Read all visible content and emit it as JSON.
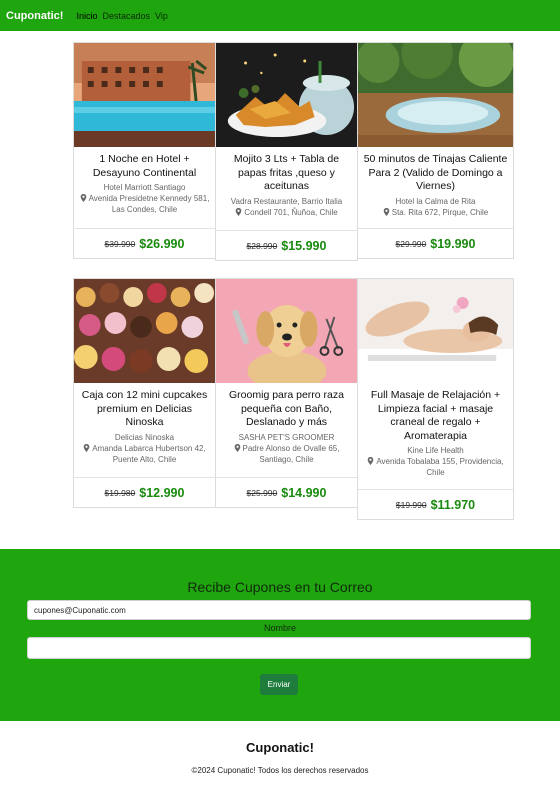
{
  "navbar": {
    "brand": "Cuponatic!",
    "links": [
      {
        "label": "Inicio"
      },
      {
        "label": "Destacados"
      },
      {
        "label": "Vip"
      }
    ]
  },
  "deals": [
    {
      "title": "1 Noche en Hotel + Desayuno Continental",
      "vendor": "Hotel Marriott Santiago",
      "address": "Avenida Presidetne Kennedy 581, Las Condes, Chile",
      "old_price": "$39.990",
      "new_price": "$26.990",
      "image_icon": "hotel-pool-photo"
    },
    {
      "title": "Mojito 3 Lts + Tabla de papas fritas ,queso y aceitunas",
      "vendor": "Vadra Restaurante, Barrio Italia",
      "address": "Condell 701, Ñuñoa, Chile",
      "old_price": "$28.990",
      "new_price": "$15.990",
      "image_icon": "fries-mojito-photo"
    },
    {
      "title": "50 minutos de Tinajas Caliente Para 2 (Valido de Domingo a Viernes)",
      "vendor": "Hotel la Calma de Rita",
      "address": "Sta. Rita 672, Pirque, Chile",
      "old_price": "$29.990",
      "new_price": "$19.990",
      "image_icon": "hot-tub-photo"
    },
    {
      "title": "Caja con 12 mini cupcakes premium en Delicias Ninoska",
      "vendor": "Delicias Ninoska",
      "address": "Amanda Labarca Hubertson 42, Puente Alto, Chile",
      "old_price": "$19.980",
      "new_price": "$12.990",
      "image_icon": "cupcakes-photo"
    },
    {
      "title": "Groomig para perro raza pequeña con Baño, Deslanado y más",
      "vendor": "SASHA PET'S GROOMER",
      "address": "Padre Alonso de Ovalle 65, Santiago, Chile",
      "old_price": "$25.990",
      "new_price": "$14.990",
      "image_icon": "dog-grooming-photo"
    },
    {
      "title": "Full Masaje de Relajación + Limpieza facial + masaje craneal de regalo + Aromaterapia",
      "vendor": "Kine Life Health",
      "address": "Avenida Tobalaba 155, Providencia, Chile",
      "old_price": "$19.990",
      "new_price": "$11.970",
      "image_icon": "massage-photo"
    }
  ],
  "newsletter": {
    "title": "Recibe Cupones en tu Correo",
    "email_value": "cupones@Cuponatic.com",
    "name_label": "Nombre",
    "button": "Enviar"
  },
  "footer": {
    "brand": "Cuponatic!",
    "copyright": "©2024 Cuponatic! Todos los derechos reservados"
  },
  "colors": {
    "brand_green": "#1fa60e",
    "price_green": "#188a0d",
    "button_green": "#1e7d3c"
  }
}
